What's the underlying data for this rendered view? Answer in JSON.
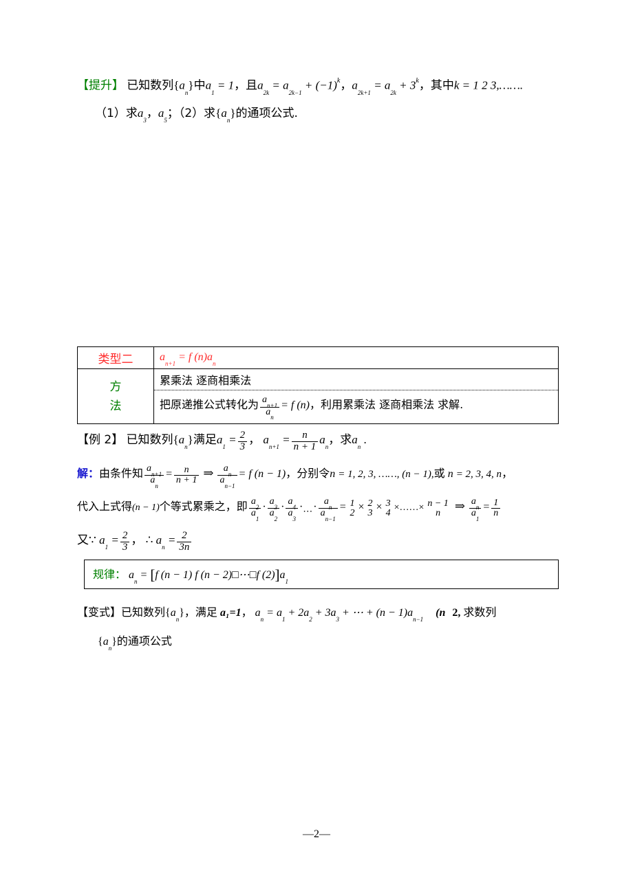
{
  "document": {
    "footer": "—2—",
    "page_number": "2"
  },
  "colors": {
    "green": "#008000",
    "red": "#ff2a2a",
    "blue": "#1a1ad0",
    "black": "#000000"
  },
  "tishen": {
    "tag": "【提升】",
    "stem_1": "已知数列",
    "seq_open": "{",
    "seq_a": "a",
    "seq_sub": "n",
    "seq_close": "}",
    "stem_2": "中",
    "a1": "a",
    "a1_sub": "1",
    "eq": "= 1",
    "comma": "，",
    "qie": "且",
    "rec1_lhs": "a",
    "rec1_lhs_sub": "2k",
    "rec1_eq": "=",
    "rec1_rhs": "a",
    "rec1_rhs_sub": "2k−1",
    "rec1_tail": "+ (−1)",
    "rec1_tail_sup": "k",
    "rec2_lhs": "a",
    "rec2_lhs_sub": "2k+1",
    "rec2_eq": "=",
    "rec2_rhs": "a",
    "rec2_rhs_sub": "2k",
    "rec2_tail": "+ 3",
    "rec2_tail_sup": "k",
    "where": "其中",
    "k": "k",
    "k_values": "= 1  2  3,…….",
    "q1_prefix": "（1）求",
    "q1_a3": "a",
    "q1_a3_sub": "3",
    "q1_sep": "，",
    "q1_a5": "a",
    "q1_a5_sub": "5",
    "q1_semicolon": "；",
    "q2_prefix": "（2）求",
    "q2_open": "{",
    "q2_a": "a",
    "q2_sub": "n",
    "q2_close": "}",
    "q2_tail": "的通项公式."
  },
  "type_table": {
    "type_label": "类型二",
    "type_formula_a": "a",
    "type_formula_sub": "n+1",
    "type_formula_eq": "=",
    "type_formula_f": "f (n)a",
    "type_formula_sub2": "n",
    "method_label_line1": "方",
    "method_label_line2": "法",
    "method_row1": "累乘法  逐商相乘法",
    "method_row2_pre": "把原递推公式转化为",
    "method_row2_frac_num": "a",
    "method_row2_frac_num_sub": "n+1",
    "method_row2_frac_den": "a",
    "method_row2_frac_den_sub": "n",
    "method_row2_eq": "= f (n)",
    "method_row2_post": "，利用累乘法  逐商相乘法  求解."
  },
  "example2": {
    "tag": "【例 2】",
    "stem": "已知数列",
    "seq_open": "{",
    "seq_a": "a",
    "seq_sub": "n",
    "seq_close": "}",
    "manzu": "满足",
    "a1": "a",
    "a1_sub": "1",
    "a1_eq": "=",
    "a1_num": "2",
    "a1_den": "3",
    "comma": "，",
    "rec_lhs": "a",
    "rec_lhs_sub": "n+1",
    "rec_eq": "=",
    "rec_num": "n",
    "rec_den": "n + 1",
    "rec_tail": "a",
    "rec_tail_sub": "n",
    "ask": "求",
    "ask_a": "a",
    "ask_sub": "n",
    "period": "."
  },
  "solution": {
    "label": "解：",
    "line1_pre": "由条件知",
    "line1_f1_num": "a",
    "line1_f1_num_sub": "n+1",
    "line1_f1_den": "a",
    "line1_f1_den_sub": "n",
    "line1_eq1": "=",
    "line1_f2_num": "n",
    "line1_f2_den": "n + 1",
    "line1_imply": "⇒",
    "line1_f3_num": "a",
    "line1_f3_num_sub": "n",
    "line1_f3_den": "a",
    "line1_f3_den_sub": "n−1",
    "line1_eq2": "= f (n − 1)",
    "line1_mid": "，分别令",
    "line1_n1": "n",
    "line1_vals1": "= 1, 2, 3, ……, (n − 1),",
    "line1_or": "或",
    "line1_n2": "n",
    "line1_vals2": "= 2, 3, 4, n",
    "line1_end": "，",
    "line2_pre": "代入上式得",
    "line2_count": "(n − 1)",
    "line2_mid": "个等式累乘之，即",
    "line2_p1_num": "a",
    "line2_p1_num_sub": "2",
    "line2_p1_den": "a",
    "line2_p1_den_sub": "1",
    "line2_p2_num": "a",
    "line2_p2_num_sub": "3",
    "line2_p2_den": "a",
    "line2_p2_den_sub": "2",
    "line2_p3_num": "a",
    "line2_p3_num_sub": "4",
    "line2_p3_den": "a",
    "line2_p3_den_sub": "3",
    "line2_dots": "⋯",
    "line2_pn_num": "a",
    "line2_pn_num_sub": "n",
    "line2_pn_den": "a",
    "line2_pn_den_sub": "n−1",
    "line2_eq": "=",
    "line2_r1_num": "1",
    "line2_r1_den": "2",
    "line2_times": "×",
    "line2_r2_num": "2",
    "line2_r2_den": "3",
    "line2_r3_num": "3",
    "line2_r3_den": "4",
    "line2_rdots": "×……×",
    "line2_rn_num": "n − 1",
    "line2_rn_den": "n",
    "line2_imply": "⇒",
    "line2_res_num": "a",
    "line2_res_num_sub": "n",
    "line2_res_den": "a",
    "line2_res_den_sub": "1",
    "line2_res_eq": "=",
    "line2_res_num2": "1",
    "line2_res_den2": "n",
    "line3_you": "又∵",
    "line3_a1": "a",
    "line3_a1_sub": "1",
    "line3_eq1": "=",
    "line3_num1": "2",
    "line3_den1": "3",
    "line3_comma": "，",
    "line3_therefore": "∴",
    "line3_an": "a",
    "line3_an_sub": "n",
    "line3_eq2": "=",
    "line3_num2": "2",
    "line3_den2": "3n"
  },
  "rule": {
    "label": "规律：",
    "an": "a",
    "an_sub": "n",
    "eq": "=",
    "bracket_open": "[",
    "body": "f (n − 1) f (n − 2)□⋯□f (2)",
    "bracket_close": "]",
    "a1": "a",
    "a1_sub": "1"
  },
  "bianshi": {
    "tag": "【变式】",
    "stem": "已知数列",
    "seq_open": "{",
    "seq_a": "a",
    "seq_sub": "n",
    "seq_close": "}",
    "comma1": "，",
    "manzu": "满足",
    "a1_eq": "a₁=1",
    "comma2": "，",
    "rec_lhs": "a",
    "rec_lhs_sub": "n",
    "rec_eq": "=",
    "rec_t1": "a",
    "rec_t1_sub": "1",
    "rec_t2": "+ 2a",
    "rec_t2_sub": "2",
    "rec_t3": "+ 3a",
    "rec_t3_sub": "3",
    "rec_dots": "+ ⋯ +",
    "rec_t4": "(n − 1)a",
    "rec_t4_sub": "n−1",
    "cond": "(n",
    "cond_val": "2,",
    "tail": "求数列",
    "line2_open": "{",
    "line2_a": "a",
    "line2_sub": "n",
    "line2_close": "}",
    "line2_tail": "的通项公式"
  }
}
